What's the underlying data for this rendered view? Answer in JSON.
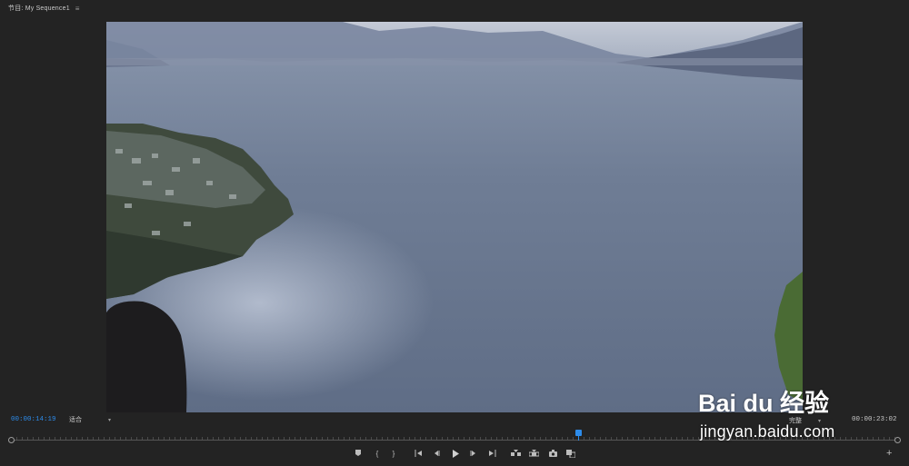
{
  "panel": {
    "title": "节目: My Sequence1",
    "menu_icon": "hamburger-icon"
  },
  "controls": {
    "current_timecode": "00:00:14:19",
    "fit_label": "适合",
    "quality_label": "完整",
    "duration_timecode": "00:00:23:02",
    "playhead_fraction": 0.64
  },
  "transport": {
    "buttons": [
      "add-marker-icon",
      "mark-in-icon",
      "mark-out-icon",
      "go-to-in-icon",
      "step-back-icon",
      "play-icon",
      "step-forward-icon",
      "go-to-out-icon",
      "insert-icon",
      "overwrite-icon",
      "export-frame-icon",
      "comparison-view-icon"
    ],
    "add_label": "+"
  },
  "watermark": {
    "brand": "Bai du 经验",
    "url": "jingyan.baidu.com"
  },
  "colors": {
    "accent": "#2d8ceb",
    "background": "#232323"
  }
}
